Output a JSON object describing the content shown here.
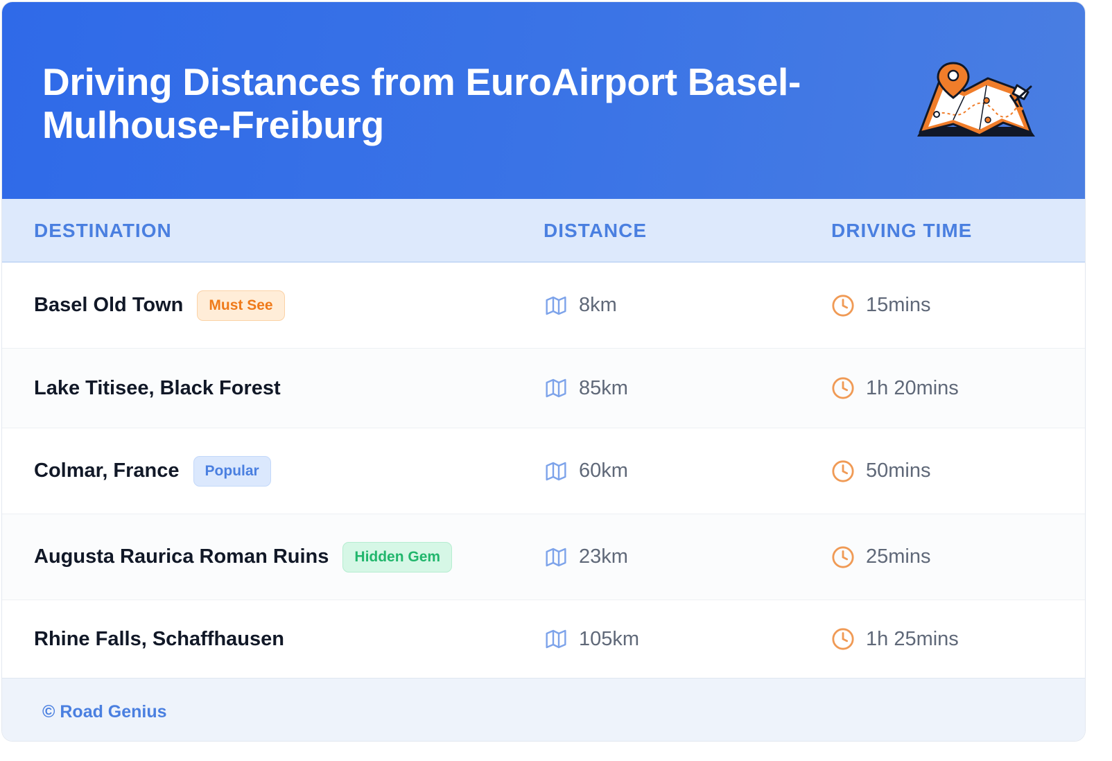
{
  "header": {
    "title": "Driving Distances from EuroAirport Basel-Mulhouse-Freiburg",
    "illustration": "map-pin-icon"
  },
  "table": {
    "columns": [
      "DESTINATION",
      "DISTANCE",
      "DRIVING TIME"
    ],
    "rows": [
      {
        "destination": "Basel Old Town",
        "badge": "Must See",
        "badge_color": "#ef7a1a",
        "distance": "8km",
        "time": "15mins"
      },
      {
        "destination": "Lake Titisee, Black Forest",
        "badge": "",
        "distance": "85km",
        "time": "1h 20mins"
      },
      {
        "destination": "Colmar, France",
        "badge": "Popular",
        "badge_color": "#4a7fe0",
        "distance": "60km",
        "time": "50mins"
      },
      {
        "destination": "Augusta Raurica Roman Ruins",
        "badge": "Hidden Gem",
        "badge_color": "#21b66c",
        "distance": "23km",
        "time": "25mins"
      },
      {
        "destination": "Rhine Falls, Schaffhausen",
        "badge": "",
        "distance": "105km",
        "time": "1h 25mins"
      }
    ],
    "icons": {
      "distance": "map-icon",
      "time": "clock-icon"
    }
  },
  "footer": {
    "text": "© Road Genius"
  },
  "colors": {
    "header_bg": "#2f6ae8",
    "accent_blue": "#4a7fe0",
    "accent_orange": "#ef7a1a"
  }
}
